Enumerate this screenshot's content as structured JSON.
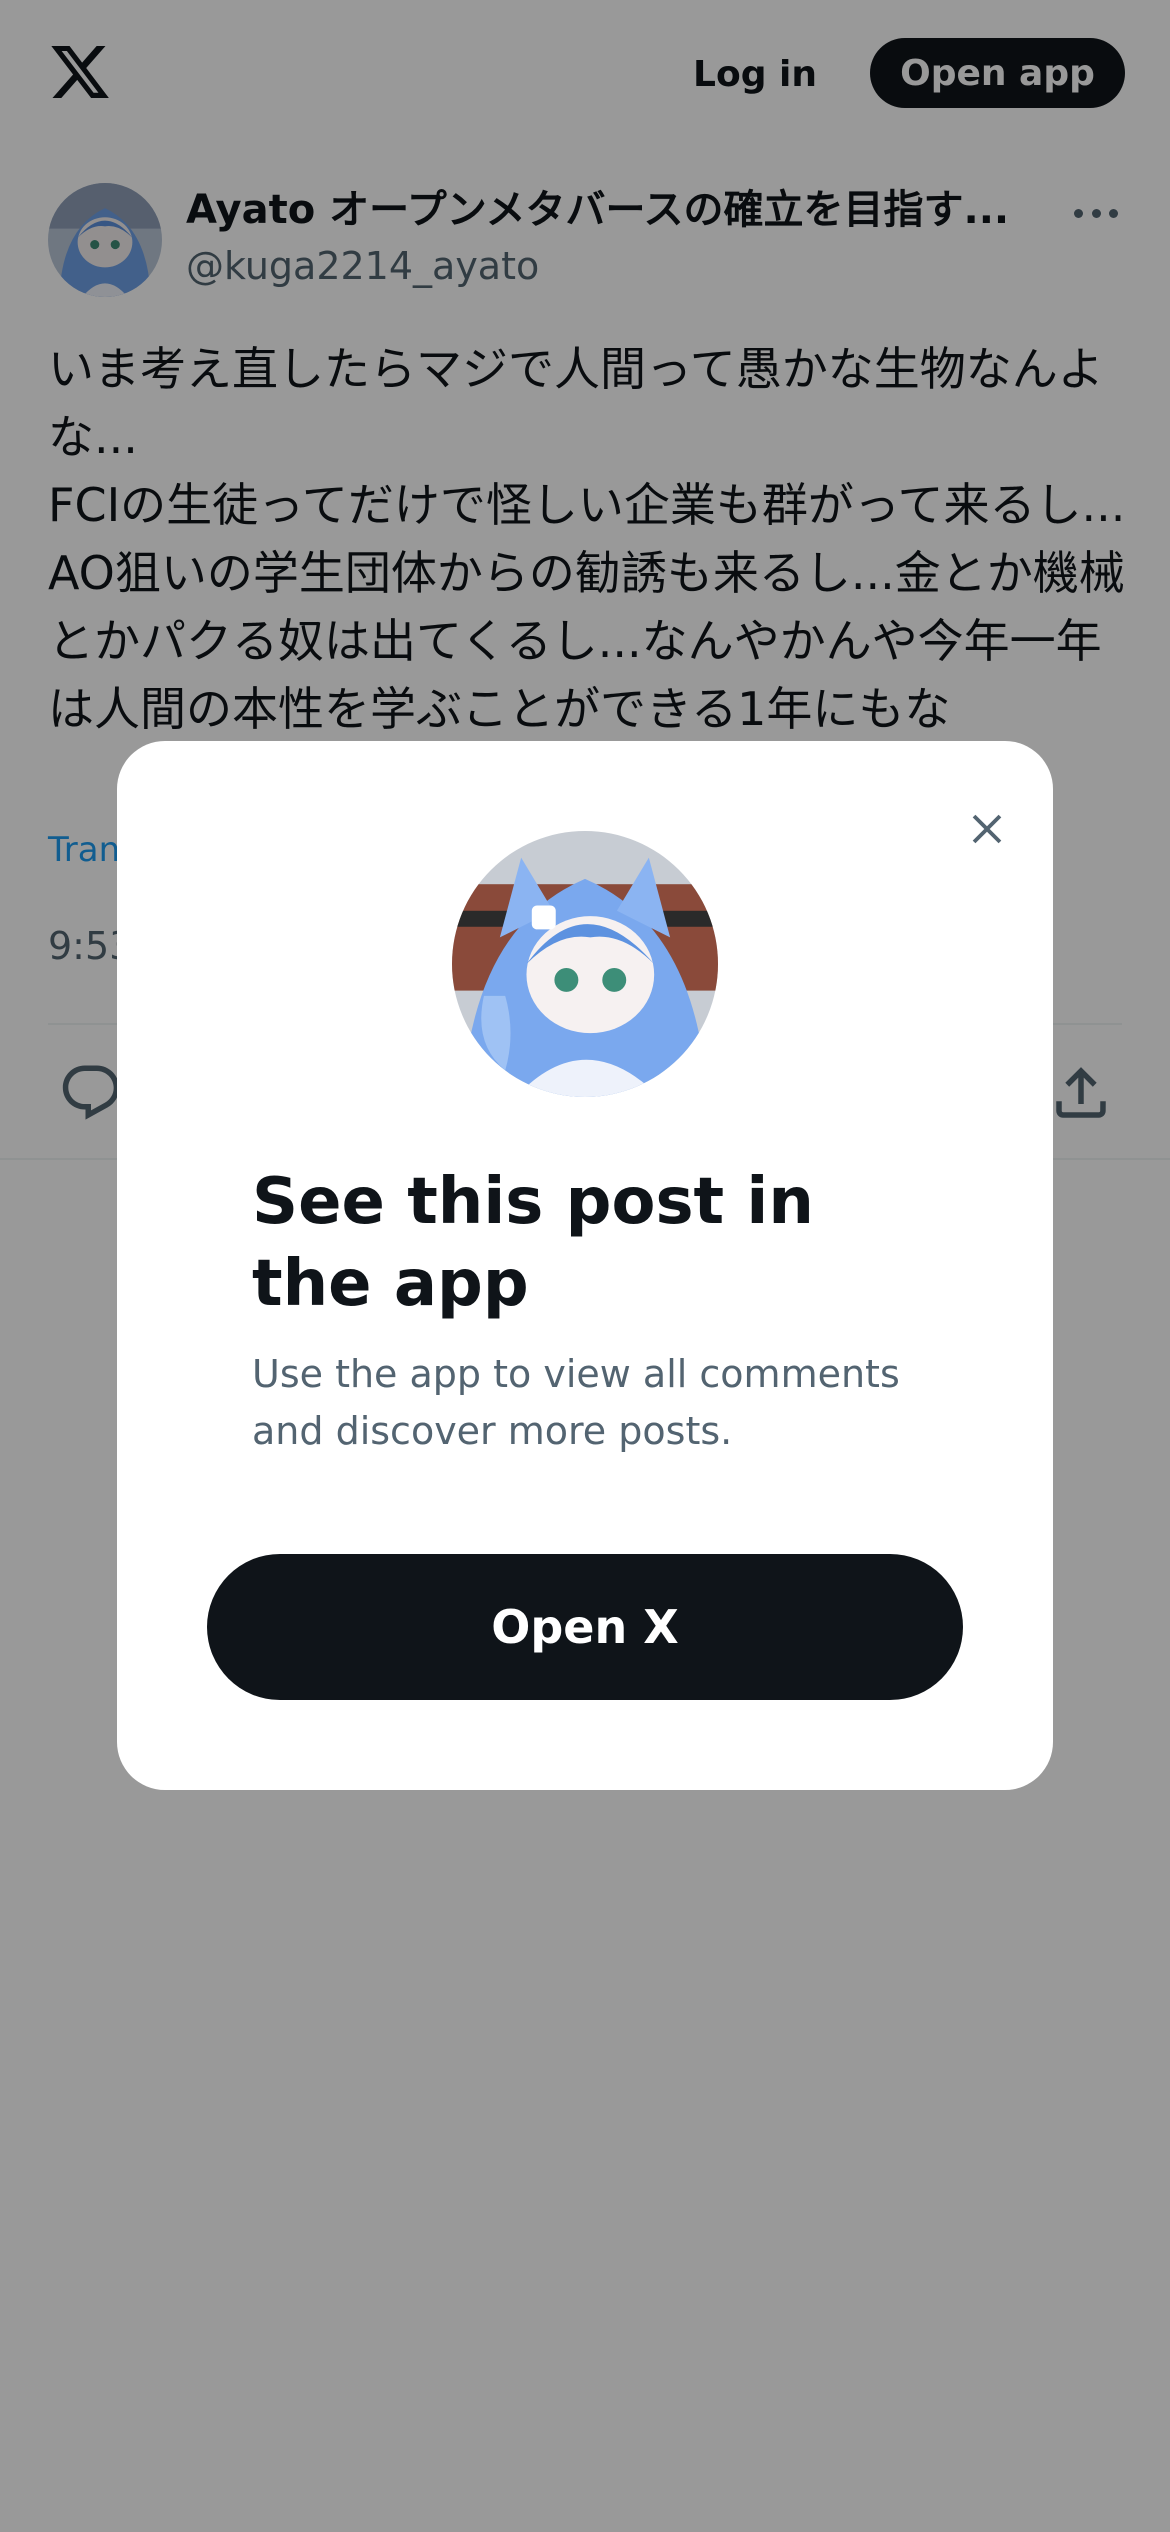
{
  "header": {
    "logo_icon": "x-logo-icon",
    "login_label": "Log in",
    "open_app_label": "Open app"
  },
  "post": {
    "avatar_icon": "avatar",
    "display_name": "Ayato オープンメタバースの確立を目指す...",
    "handle": "@kuga2214_ayato",
    "more_icon": "more-horizontal-icon",
    "text": "いま考え直したらマジで人間って愚かな生物なんよな...\nFCIの生徒ってだけで怪しい企業も群がって来るし...AO狙いの学生団体からの勧誘も来るし...金とか機械とかパクる奴は出てくるし...なんやかんや今年一年は人間の本性を学ぶことができる1年にもな",
    "translate_label": "Tran",
    "timestamp": "9:53",
    "actions": {
      "reply_icon": "reply-icon",
      "share_icon": "share-icon"
    }
  },
  "modal": {
    "close_icon": "close-icon",
    "avatar_icon": "avatar",
    "title": "See this post in the app",
    "subtitle": "Use the app to view all comments and discover more posts.",
    "button_label": "Open X"
  },
  "colors": {
    "text_primary": "#0f1419",
    "text_secondary": "#536471",
    "link": "#1d9bf0",
    "button_dark": "#0f1419",
    "overlay": "rgba(0,0,0,0.4)"
  }
}
